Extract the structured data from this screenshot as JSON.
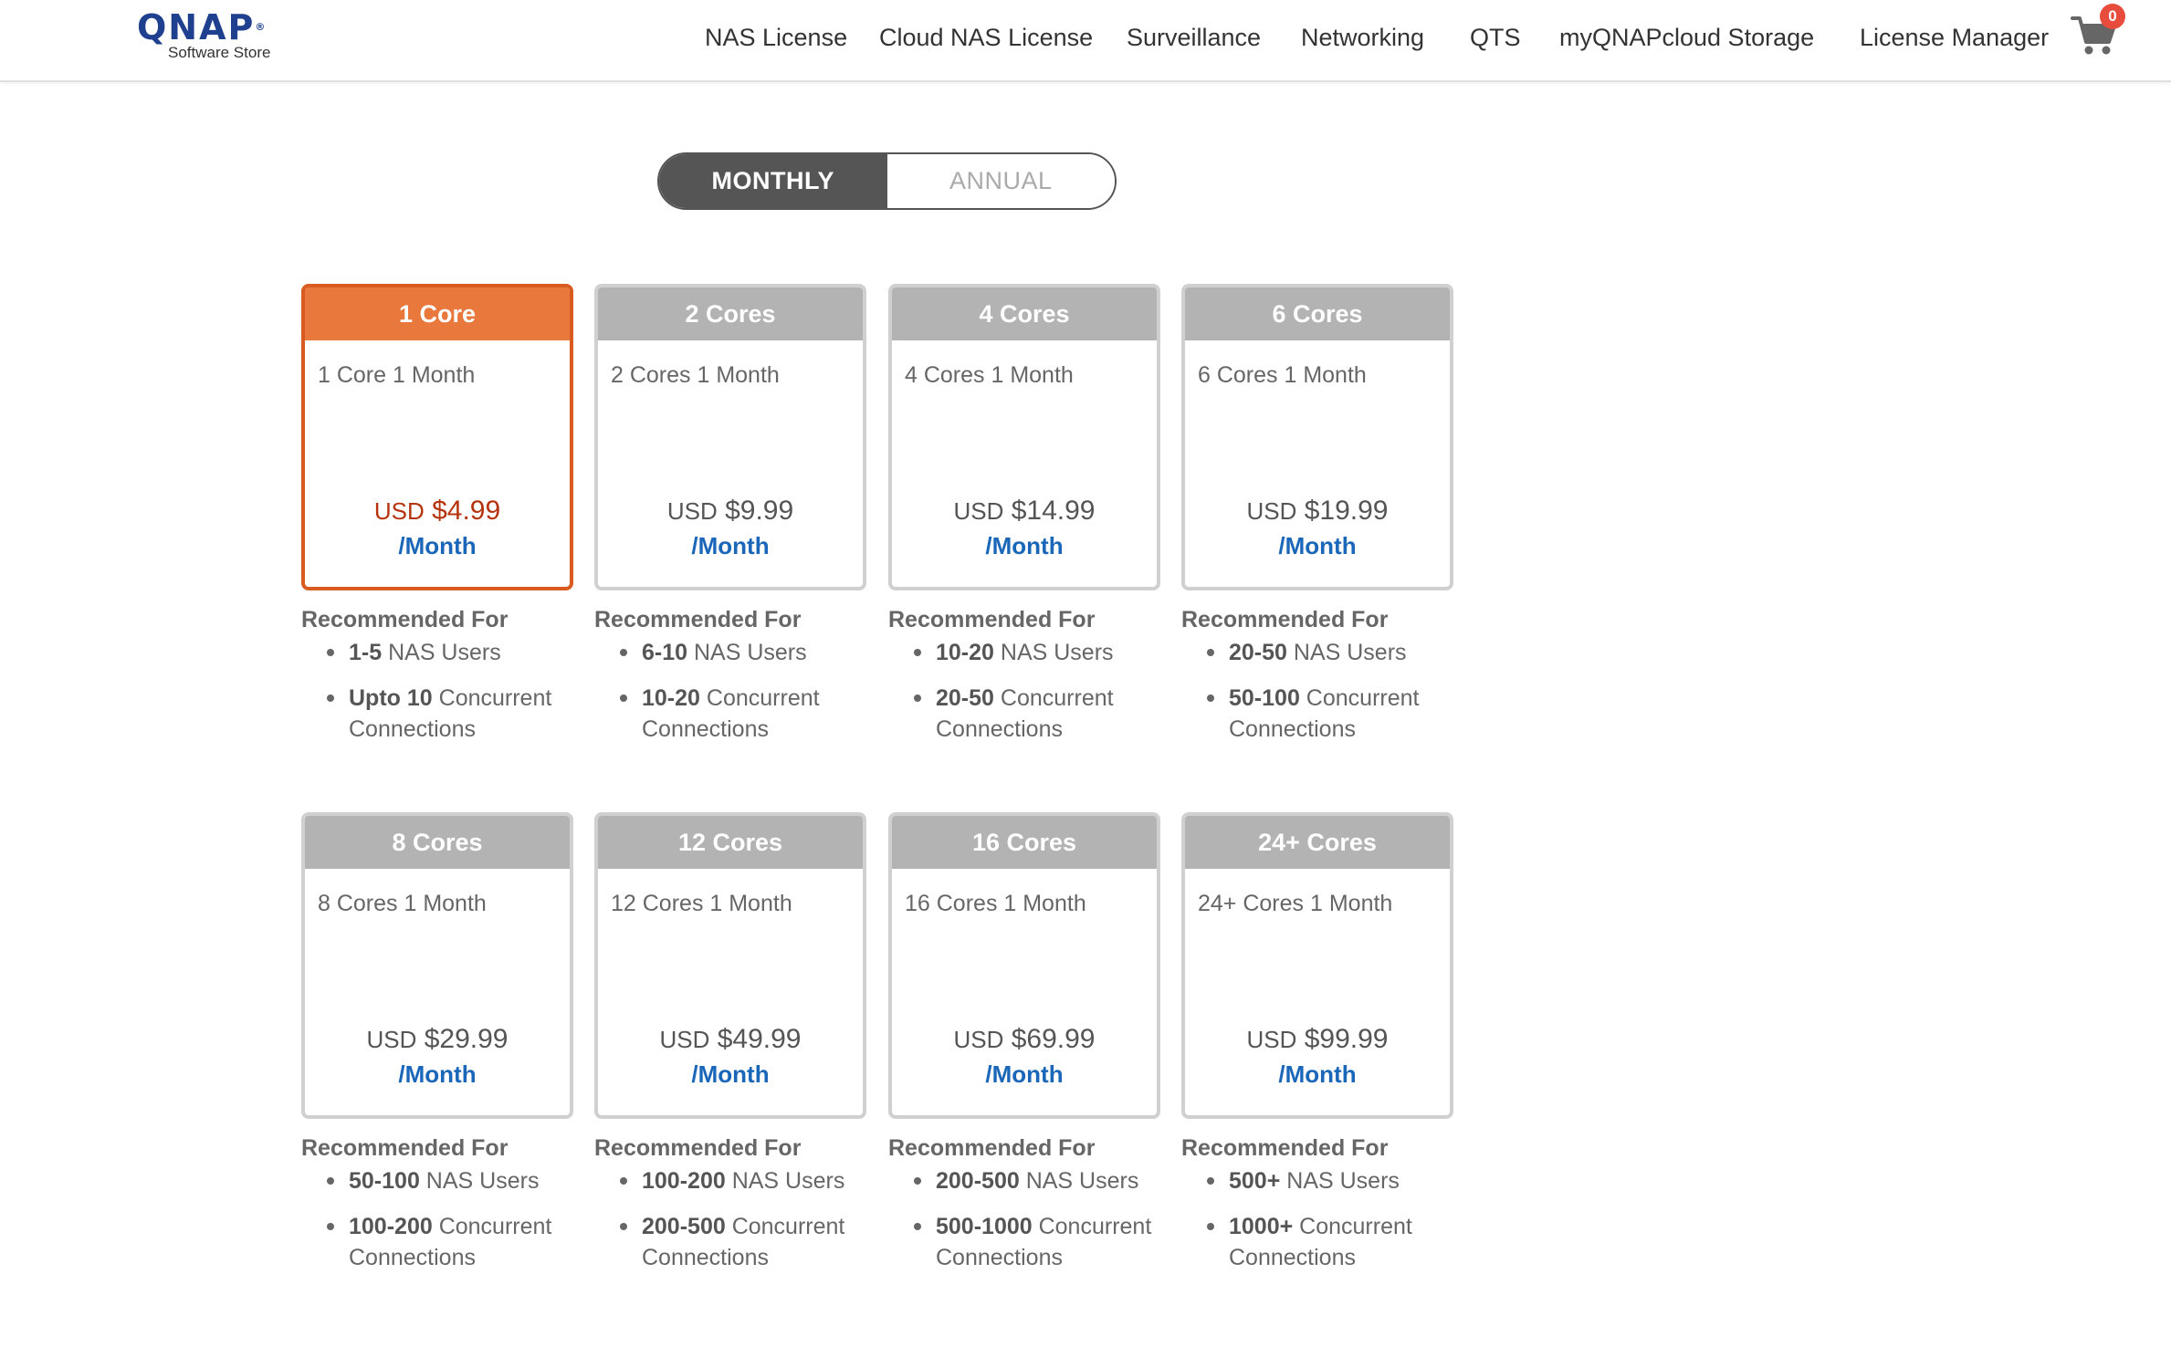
{
  "logo": {
    "brand": "QNAP",
    "sub": "Software Store"
  },
  "nav": [
    "NAS License",
    "Cloud NAS License",
    "Surveillance",
    "Networking",
    "QTS",
    "myQNAPcloud Storage",
    "License Manager"
  ],
  "cart": {
    "icon": "cart-icon",
    "count": "0"
  },
  "toggle": {
    "monthly": "MONTHLY",
    "annual": "ANNUAL",
    "selected": "monthly"
  },
  "labels": {
    "recommended": "Recommended For",
    "period": "/Month",
    "currency": "USD"
  },
  "plans": [
    {
      "title": "1 Core",
      "desc": "1 Core 1 Month",
      "price": "$4.99",
      "users_bold": "1-5",
      "users_text": " NAS Users",
      "conn_bold": "Upto 10",
      "conn_text": " Concurrent Connections",
      "selected": true
    },
    {
      "title": "2 Cores",
      "desc": "2 Cores 1 Month",
      "price": "$9.99",
      "users_bold": "6-10",
      "users_text": " NAS Users",
      "conn_bold": "10-20",
      "conn_text": " Concurrent Connections"
    },
    {
      "title": "4 Cores",
      "desc": "4 Cores 1 Month",
      "price": "$14.99",
      "users_bold": "10-20",
      "users_text": " NAS Users",
      "conn_bold": "20-50",
      "conn_text": " Concurrent Connections"
    },
    {
      "title": "6 Cores",
      "desc": "6 Cores 1 Month",
      "price": "$19.99",
      "users_bold": "20-50",
      "users_text": " NAS Users",
      "conn_bold": "50-100",
      "conn_text": " Concurrent Connections"
    },
    {
      "title": "8 Cores",
      "desc": "8 Cores 1 Month",
      "price": "$29.99",
      "users_bold": "50-100",
      "users_text": " NAS Users",
      "conn_bold": "100-200",
      "conn_text": " Concurrent Connections"
    },
    {
      "title": "12 Cores",
      "desc": "12 Cores 1 Month",
      "price": "$49.99",
      "users_bold": "100-200",
      "users_text": " NAS Users",
      "conn_bold": "200-500",
      "conn_text": " Concurrent Connections"
    },
    {
      "title": "16 Cores",
      "desc": "16 Cores 1 Month",
      "price": "$69.99",
      "users_bold": "200-500",
      "users_text": " NAS Users",
      "conn_bold": "500-1000",
      "conn_text": " Concurrent Connections"
    },
    {
      "title": "24+ Cores",
      "desc": "24+ Cores 1 Month",
      "price": "$99.99",
      "users_bold": "500+",
      "users_text": " NAS Users",
      "conn_bold": "1000+",
      "conn_text": " Concurrent Connections"
    }
  ]
}
